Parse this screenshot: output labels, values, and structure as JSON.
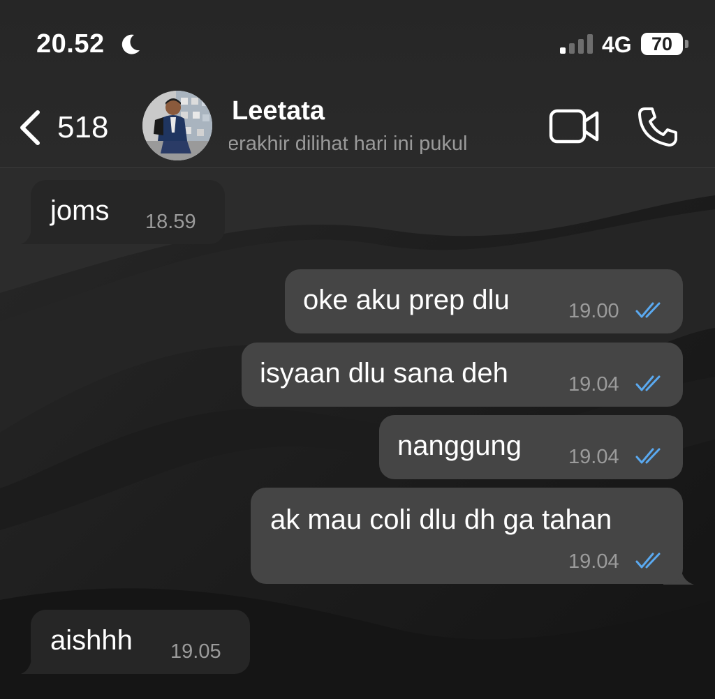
{
  "status_bar": {
    "time": "20.52",
    "network": "4G",
    "battery": "70"
  },
  "header": {
    "back_count": "518",
    "contact_name": "Leetata",
    "last_seen": "terakhir dilihat hari ini pukul"
  },
  "messages": [
    {
      "direction": "incoming",
      "text": "joms",
      "time": "18.59"
    },
    {
      "direction": "outgoing",
      "text": "oke aku prep dlu",
      "time": "19.00",
      "status": "read"
    },
    {
      "direction": "outgoing",
      "text": "isyaan dlu sana deh",
      "time": "19.04",
      "status": "read"
    },
    {
      "direction": "outgoing",
      "text": "nanggung",
      "time": "19.04",
      "status": "read"
    },
    {
      "direction": "outgoing",
      "text": "ak mau coli dlu dh ga tahan",
      "time": "19.04",
      "status": "read"
    },
    {
      "direction": "incoming",
      "text": "aishhh",
      "time": "19.05"
    }
  ],
  "colors": {
    "read_ticks": "#5aa9f0",
    "incoming_bubble": "#262626",
    "outgoing_bubble": "#454545"
  },
  "icons": {
    "moon": "moon-icon",
    "signal": "signal-icon",
    "back": "chevron-left-icon",
    "video": "video-camera-icon",
    "call": "phone-icon",
    "read": "double-check-icon"
  }
}
